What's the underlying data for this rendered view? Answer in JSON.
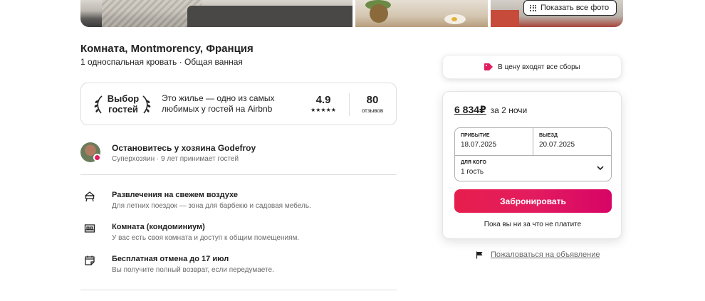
{
  "photos": {
    "show_all_label": "Показать все фото"
  },
  "listing": {
    "title": "Комната, Montmorency, Франция",
    "subtitle": "1 односпальная кровать · Общая ванная"
  },
  "guest_favorite": {
    "badge": "Выбор гостей",
    "text": "Это жилье — одно из самых любимых у гостей на Airbnb",
    "rating": "4.9",
    "stars": "★★★★★",
    "reviews_count": "80",
    "reviews_label": "отзывов"
  },
  "host": {
    "title": "Остановитесь у хозяина Godefroy",
    "subtitle": "Суперхозяин · 9 лет принимает гостей"
  },
  "features": [
    {
      "icon": "outdoor-grill-icon",
      "title": "Развлечения на свежем воздухе",
      "desc": "Для летних поездок — зона для барбекю и садовая мебель."
    },
    {
      "icon": "room-icon",
      "title": "Комната (кондоминиум)",
      "desc": "У вас есть своя комната и доступ к общим помещениям."
    },
    {
      "icon": "calendar-icon",
      "title": "Бесплатная отмена до 17 июл",
      "desc": "Вы получите полный возврат, если передумаете."
    }
  ],
  "fees_notice": "В цену входят все сборы",
  "booking": {
    "price": "6 834₽",
    "price_suffix": "за 2 ночи",
    "checkin_label": "ПРИБЫТИЕ",
    "checkin_value": "18.07.2025",
    "checkout_label": "ВЫЕЗД",
    "checkout_value": "20.07.2025",
    "guests_label": "ДЛЯ КОГО",
    "guests_value": "1 гость",
    "reserve_label": "Забронировать",
    "no_charge": "Пока вы ни за что не платите"
  },
  "report_label": "Пожаловаться на объявление",
  "colors": {
    "brand": "#e31c5f",
    "text": "#222222",
    "muted": "#6a6a6a",
    "border": "#dddddd"
  }
}
